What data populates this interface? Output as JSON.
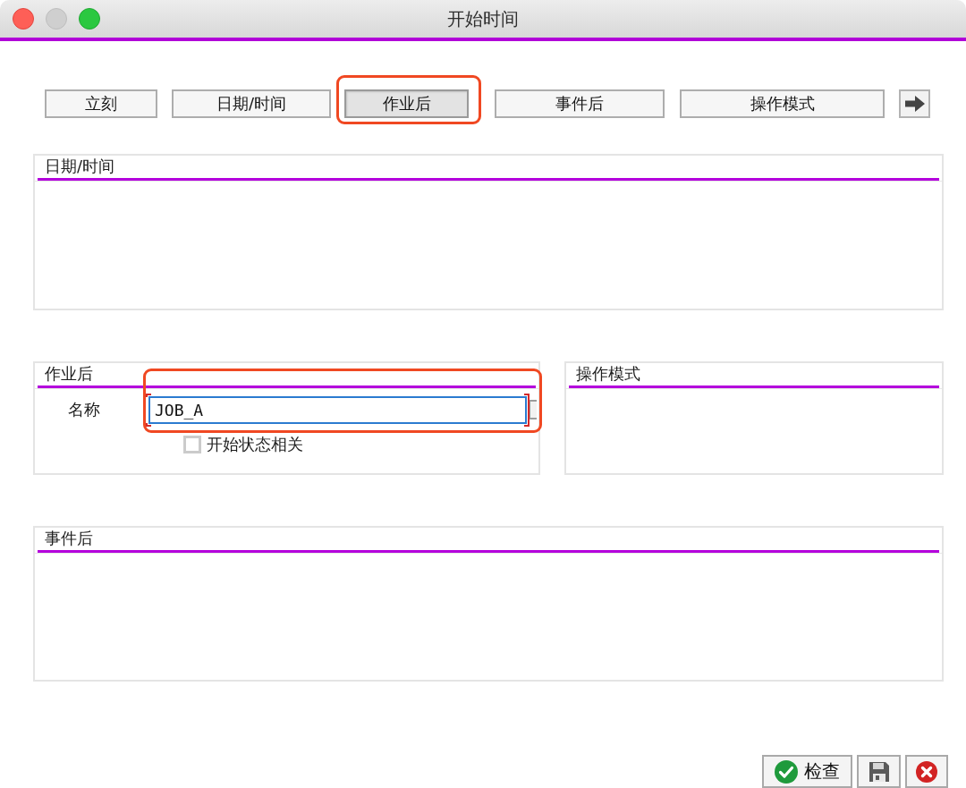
{
  "window": {
    "title": "开始时间"
  },
  "tabs": [
    {
      "label": "立刻",
      "selected": false,
      "highlighted": false
    },
    {
      "label": "日期/时间",
      "selected": false,
      "highlighted": false
    },
    {
      "label": "作业后",
      "selected": true,
      "highlighted": true
    },
    {
      "label": "事件后",
      "selected": false,
      "highlighted": false
    },
    {
      "label": "操作模式",
      "selected": false,
      "highlighted": false
    }
  ],
  "date_time_panel": {
    "title": "日期/时间"
  },
  "after_job_panel": {
    "title": "作业后",
    "name_field": {
      "label": "名称",
      "value": "JOB_A",
      "highlighted": true
    },
    "checkbox": {
      "label": "开始状态相关",
      "checked": false
    }
  },
  "operation_mode_panel": {
    "title": "操作模式"
  },
  "after_event_panel": {
    "title": "事件后"
  },
  "footer_buttons": [
    {
      "kind": "check",
      "label": "检查"
    },
    {
      "kind": "save"
    },
    {
      "kind": "cancel"
    }
  ]
}
